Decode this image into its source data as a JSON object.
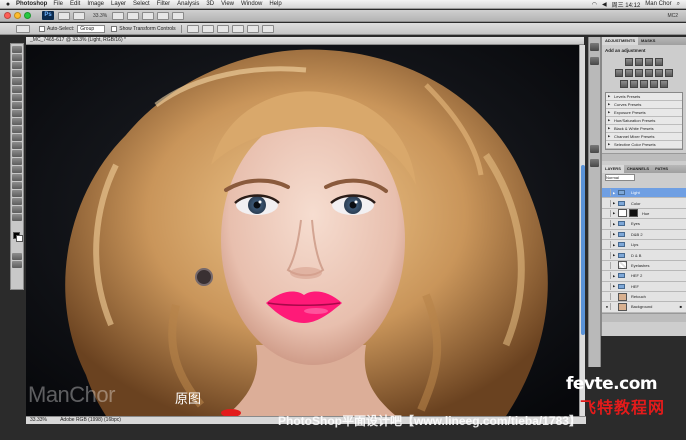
{
  "menubar": {
    "app_name": "Photoshop",
    "items": [
      "File",
      "Edit",
      "Image",
      "Layer",
      "Select",
      "Filter",
      "Analysis",
      "3D",
      "View",
      "Window",
      "Help"
    ],
    "clock": "周三 14:12",
    "user": "Man Chor"
  },
  "appbar": {
    "badge": "Ps",
    "zoom": "33.3%",
    "workspace": "MC2"
  },
  "options": {
    "auto_select_label": "Auto-Select:",
    "auto_select_value": "Group",
    "show_transform_label": "Show Transform Controls"
  },
  "document": {
    "tab_title": "_MC_7465-617 @ 33.3% (Light, RGB/16) *",
    "status_zoom": "33.33%",
    "status_info": "Adobe RGB (1998) (16bpc)"
  },
  "adjustments_panel": {
    "tabs": [
      "ADJUSTMENTS",
      "MASKS"
    ],
    "heading": "Add an adjustment",
    "presets": [
      "Levels Presets",
      "Curves Presets",
      "Exposure Presets",
      "Hue/Saturation Presets",
      "Black & White Presets",
      "Channel Mixer Presets",
      "Selective Color Presets"
    ]
  },
  "layers_panel": {
    "tabs": [
      "LAYERS",
      "CHANNELS",
      "PATHS"
    ],
    "blend_mode": "Normal",
    "layers": [
      {
        "name": "Light",
        "type": "folder",
        "selected": true
      },
      {
        "name": "Color",
        "type": "folder"
      },
      {
        "name": "Hue",
        "type": "adjustment"
      },
      {
        "name": "Eyes",
        "type": "folder"
      },
      {
        "name": "D&B 2",
        "type": "folder"
      },
      {
        "name": "Lips",
        "type": "folder"
      },
      {
        "name": "D & B",
        "type": "folder"
      },
      {
        "name": "Eyelashes",
        "type": "layer"
      },
      {
        "name": "HEF 2",
        "type": "folder"
      },
      {
        "name": "HEF",
        "type": "folder"
      },
      {
        "name": "Retouch",
        "type": "photo"
      },
      {
        "name": "Background",
        "type": "photo",
        "visible": true
      }
    ]
  },
  "watermarks": {
    "author": "ManChor",
    "caption": "原图",
    "site_logo_top": "fevte.com",
    "site_logo_bottom": "飞特教程网",
    "bottom_banner": "PhotoShop平面设计吧【www.lineeg.com/tieba/1783】"
  },
  "colors": {
    "lips": "#ff1a78",
    "hair": "#c89a63",
    "selection_blue": "#6f9fe3",
    "accent_red": "#e31b1b"
  }
}
